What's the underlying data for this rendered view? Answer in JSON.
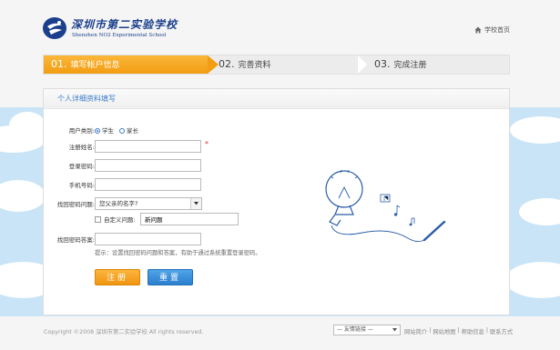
{
  "header": {
    "logo_cn": "深圳市第二实验学校",
    "logo_en": "Shenzhen NO2 Experimental School",
    "home_link": "学校首页"
  },
  "steps": [
    {
      "num": "01.",
      "label": "填写帐户信息",
      "active": true
    },
    {
      "num": "02.",
      "label": "完善资料",
      "active": false
    },
    {
      "num": "03.",
      "label": "完成注册",
      "active": false
    }
  ],
  "panel": {
    "title": "个人详细资料填写"
  },
  "form": {
    "user_type_label": "用户类别:",
    "user_type_options": [
      "学生",
      "家长"
    ],
    "user_type_selected": "学生",
    "name_label": "注册姓名:",
    "name_value": "",
    "required_mark": "*",
    "password_label": "登录密码:",
    "password_value": "",
    "phone_label": "手机号码:",
    "phone_value": "",
    "question_label": "找回密码问题:",
    "question_selected": "您父亲的名字?",
    "custom_question_label": "自定义问题:",
    "custom_question_value": "新问题",
    "answer_label": "找回密码答案:",
    "answer_value": "",
    "hint": "提示：设置找回密码问题和答案，有助于通过系统重置登录密码。",
    "submit_label": "注册",
    "reset_label": "重置"
  },
  "footer": {
    "copyright": "Copyright ©2008 深圳市第二实验学校 All rights reserved.",
    "friend_links_placeholder": "— 友情链接 —",
    "links": [
      "网站简介",
      "网站地图",
      "帮助信息",
      "联系方式"
    ],
    "separator": "|"
  },
  "colors": {
    "accent_orange": "#f29d12",
    "accent_blue": "#3a7bc8",
    "logo_blue": "#1b3f8c",
    "sky": "#c9e4f6"
  }
}
